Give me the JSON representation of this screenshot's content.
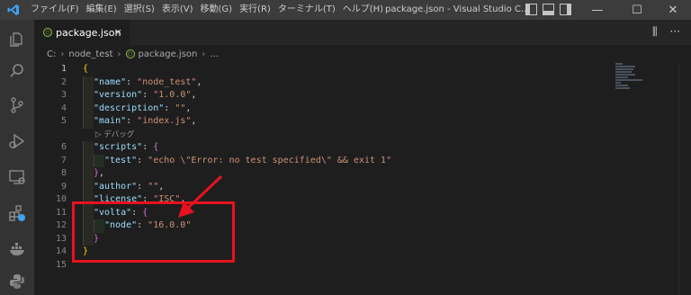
{
  "menu": [
    "ファイル(F)",
    "編集(E)",
    "選択(S)",
    "表示(V)",
    "移動(G)",
    "実行(R)",
    "ターミナル(T)",
    "ヘルプ(H)"
  ],
  "window_title": "package.json - Visual Studio C...",
  "window_controls": {
    "minimize": "—",
    "maximize": "☐",
    "close": "✕"
  },
  "tab": {
    "label": "package.json",
    "close": "×"
  },
  "tab_actions": {
    "split": "⫼",
    "more": "···"
  },
  "breadcrumb": {
    "drive": "C:",
    "folder": "node_test",
    "file": "package.json",
    "more": "..."
  },
  "line_numbers": [
    "1",
    "2",
    "3",
    "4",
    "5",
    "6",
    "7",
    "8",
    "9",
    "10",
    "11",
    "12",
    "13",
    "14",
    "15"
  ],
  "codelens": "▷ デバッグ",
  "code": {
    "l1": "{",
    "name_key": "\"name\"",
    "name_val": "\"node_test\"",
    "version_key": "\"version\"",
    "version_val": "\"1.0.0\"",
    "description_key": "\"description\"",
    "description_val": "\"\"",
    "main_key": "\"main\"",
    "main_val": "\"index.js\"",
    "scripts_key": "\"scripts\"",
    "test_key": "\"test\"",
    "test_val": "\"echo \\\"Error: no test specified\\\" && exit 1\"",
    "close_brace_comma": "}",
    "author_key": "\"author\"",
    "author_val": "\"\"",
    "license_key": "\"license\"",
    "license_val": "\"ISC\"",
    "volta_key": "\"volta\"",
    "node_key": "\"node\"",
    "node_val": "\"16.0.0\"",
    "close_inner": "}",
    "close_outer": "}"
  },
  "colors": {
    "accent_annotation": "#e8111f",
    "key": "#9cdcfe",
    "string": "#ce9178",
    "brace": "#ffd700"
  }
}
